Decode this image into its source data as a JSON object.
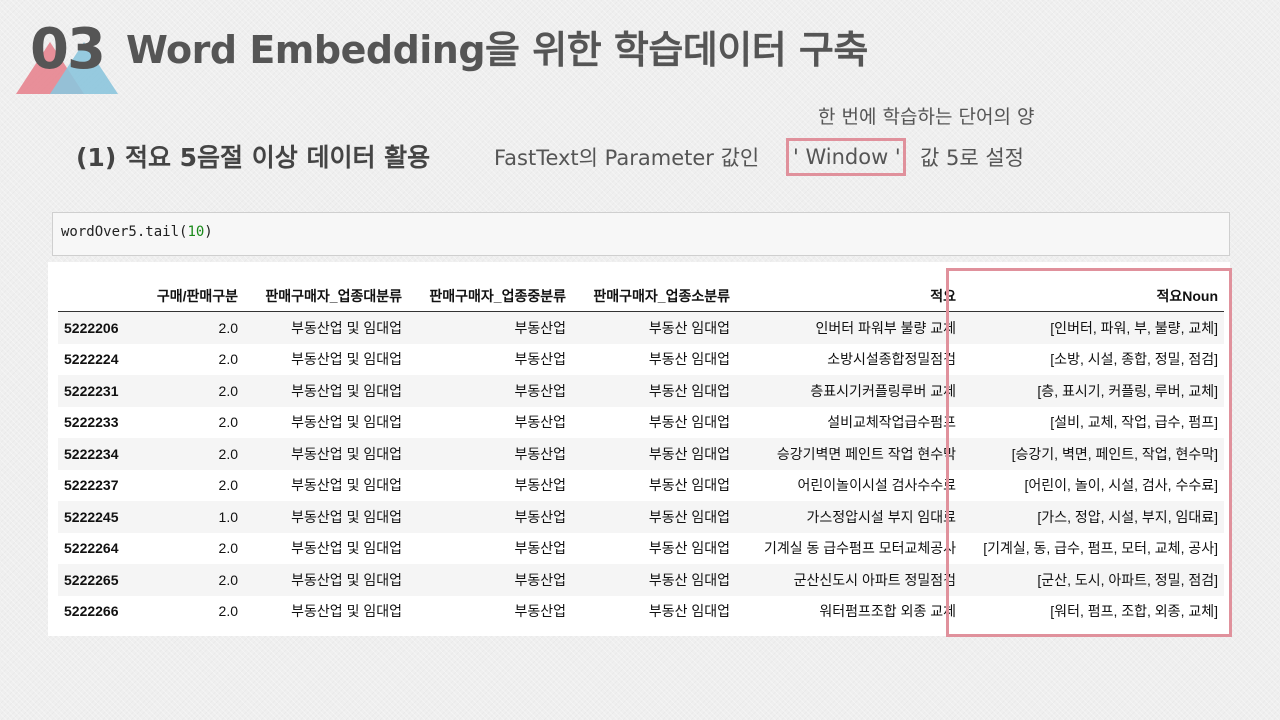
{
  "slide": {
    "number": "03",
    "title": "Word Embedding을 위한 학습데이터 구축",
    "subtitle": "(1) 적요 5음절 이상 데이터 활용",
    "annotation": "한 번에 학습하는 단어의 양",
    "param_prefix": "FastText의 Parameter 값인",
    "param_name": "' Window '",
    "param_suffix": "값 5로 설정",
    "accent_color": "#e0919c",
    "logo_colors": [
      "#e7848f",
      "#8cc5dd"
    ]
  },
  "code": {
    "prefix": "wordOver5.tail(",
    "arg": "10",
    "suffix": ")"
  },
  "table": {
    "columns": [
      "",
      "구매/판매구분",
      "판매구매자_업종대분류",
      "판매구매자_업종중분류",
      "판매구매자_업종소분류",
      "적요",
      "적요Noun"
    ],
    "rows": [
      [
        "5222206",
        "2.0",
        "부동산업 및 임대업",
        "부동산업",
        "부동산 임대업",
        "인버터 파워부 불량 교체",
        "[인버터, 파워, 부, 불량, 교체]"
      ],
      [
        "5222224",
        "2.0",
        "부동산업 및 임대업",
        "부동산업",
        "부동산 임대업",
        "소방시설종합정밀점검",
        "[소방, 시설, 종합, 정밀, 점검]"
      ],
      [
        "5222231",
        "2.0",
        "부동산업 및 임대업",
        "부동산업",
        "부동산 임대업",
        "층표시기커플링루버 교체",
        "[층, 표시기, 커플링, 루버, 교체]"
      ],
      [
        "5222233",
        "2.0",
        "부동산업 및 임대업",
        "부동산업",
        "부동산 임대업",
        "설비교체작업급수펌프",
        "[설비, 교체, 작업, 급수, 펌프]"
      ],
      [
        "5222234",
        "2.0",
        "부동산업 및 임대업",
        "부동산업",
        "부동산 임대업",
        "승강기벽면 페인트 작업 현수막",
        "[승강기, 벽면, 페인트, 작업, 현수막]"
      ],
      [
        "5222237",
        "2.0",
        "부동산업 및 임대업",
        "부동산업",
        "부동산 임대업",
        "어린이놀이시설 검사수수료",
        "[어린이, 놀이, 시설, 검사, 수수료]"
      ],
      [
        "5222245",
        "1.0",
        "부동산업 및 임대업",
        "부동산업",
        "부동산 임대업",
        "가스정압시설 부지 임대료",
        "[가스, 정압, 시설, 부지, 임대료]"
      ],
      [
        "5222264",
        "2.0",
        "부동산업 및 임대업",
        "부동산업",
        "부동산 임대업",
        "기계실 동 급수펌프 모터교체공사",
        "[기계실, 동, 급수, 펌프, 모터, 교체, 공사]"
      ],
      [
        "5222265",
        "2.0",
        "부동산업 및 임대업",
        "부동산업",
        "부동산 임대업",
        "군산신도시 아파트 정밀점검",
        "[군산, 도시, 아파트, 정밀, 점검]"
      ],
      [
        "5222266",
        "2.0",
        "부동산업 및 임대업",
        "부동산업",
        "부동산 임대업",
        "워터펌프조합 외종 교체",
        "[워터, 펌프, 조합, 외종, 교체]"
      ]
    ]
  }
}
